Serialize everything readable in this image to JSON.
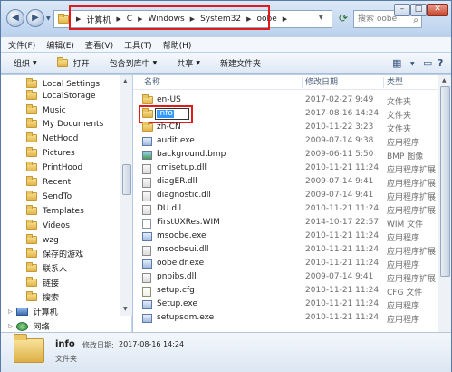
{
  "address": {
    "crumbs": [
      "计算机",
      "C",
      "Windows",
      "System32",
      "oobe"
    ]
  },
  "search": {
    "placeholder": "搜索 oobe"
  },
  "menu": [
    "文件(F)",
    "编辑(E)",
    "查看(V)",
    "工具(T)",
    "帮助(H)"
  ],
  "toolbar": {
    "organize": "组织",
    "open": "打开",
    "include_library": "包含到库中",
    "share": "共享",
    "new_folder": "新建文件夹"
  },
  "nav_items": [
    {
      "label": "Local Settings",
      "icon": "folder-icon"
    },
    {
      "label": "LocalStorage",
      "icon": "folder-icon"
    },
    {
      "label": "Music",
      "icon": "folder-icon"
    },
    {
      "label": "My Documents",
      "icon": "folder-icon"
    },
    {
      "label": "NetHood",
      "icon": "folder-icon"
    },
    {
      "label": "Pictures",
      "icon": "folder-icon"
    },
    {
      "label": "PrintHood",
      "icon": "folder-icon"
    },
    {
      "label": "Recent",
      "icon": "folder-icon"
    },
    {
      "label": "SendTo",
      "icon": "folder-icon"
    },
    {
      "label": "Templates",
      "icon": "folder-icon"
    },
    {
      "label": "Videos",
      "icon": "folder-icon"
    },
    {
      "label": "wzg",
      "icon": "folder-icon"
    },
    {
      "label": "保存的游戏",
      "icon": "folder-icon"
    },
    {
      "label": "联系人",
      "icon": "folder-icon"
    },
    {
      "label": "链接",
      "icon": "folder-icon"
    },
    {
      "label": "搜索",
      "icon": "folder-icon"
    },
    {
      "label": "计算机",
      "icon": "computer-icon"
    },
    {
      "label": "网络",
      "icon": "network-icon"
    }
  ],
  "columns": {
    "name": "名称",
    "date": "修改日期",
    "type": "类型"
  },
  "files": [
    {
      "name": "en-US",
      "date": "2017-02-27 9:49",
      "type": "文件夹",
      "icon": "folder"
    },
    {
      "name": "info",
      "date": "2017-08-16 14:24",
      "type": "文件夹",
      "icon": "folder",
      "renaming": true
    },
    {
      "name": "zh-CN",
      "date": "2010-11-22 3:23",
      "type": "文件夹",
      "icon": "folder"
    },
    {
      "name": "audit.exe",
      "date": "2009-07-14 9:38",
      "type": "应用程序",
      "icon": "exe"
    },
    {
      "name": "background.bmp",
      "date": "2009-06-11 5:50",
      "type": "BMP 图像",
      "icon": "bmp"
    },
    {
      "name": "cmisetup.dll",
      "date": "2010-11-21 11:24",
      "type": "应用程序扩展",
      "icon": "dll"
    },
    {
      "name": "diagER.dll",
      "date": "2009-07-14 9:41",
      "type": "应用程序扩展",
      "icon": "dll"
    },
    {
      "name": "diagnostic.dll",
      "date": "2009-07-14 9:41",
      "type": "应用程序扩展",
      "icon": "dll"
    },
    {
      "name": "DU.dll",
      "date": "2010-11-21 11:24",
      "type": "应用程序扩展",
      "icon": "dll"
    },
    {
      "name": "FirstUXRes.WIM",
      "date": "2014-10-17 22:57",
      "type": "WIM 文件",
      "icon": "wim"
    },
    {
      "name": "msoobe.exe",
      "date": "2010-11-21 11:24",
      "type": "应用程序",
      "icon": "exe"
    },
    {
      "name": "msoobeui.dll",
      "date": "2010-11-21 11:24",
      "type": "应用程序扩展",
      "icon": "dll"
    },
    {
      "name": "oobeldr.exe",
      "date": "2010-11-21 11:24",
      "type": "应用程序",
      "icon": "exe"
    },
    {
      "name": "pnpibs.dll",
      "date": "2009-07-14 9:41",
      "type": "应用程序扩展",
      "icon": "dll"
    },
    {
      "name": "setup.cfg",
      "date": "2010-11-21 11:24",
      "type": "CFG 文件",
      "icon": "cfg"
    },
    {
      "name": "Setup.exe",
      "date": "2010-11-21 11:24",
      "type": "应用程序",
      "icon": "exe"
    },
    {
      "name": "setupsqm.exe",
      "date": "2010-11-21 11:24",
      "type": "应用程序",
      "icon": "exe"
    }
  ],
  "details": {
    "name": "info",
    "modified_label": "修改日期:",
    "modified_value": "2017-08-16 14:24",
    "type": "文件夹"
  },
  "colors": {
    "highlight": "#e11b1b",
    "selection": "#3399ff",
    "accent": "#3a5780"
  }
}
